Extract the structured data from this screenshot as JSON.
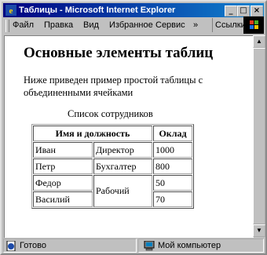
{
  "window": {
    "title": "Таблицы - Microsoft Internet Explorer",
    "buttons": {
      "minimize": "_",
      "maximize": "□",
      "close": "×"
    }
  },
  "menu": {
    "items": [
      "Файл",
      "Правка",
      "Вид",
      "Избранное",
      "Сервис"
    ],
    "links_label": "Ссылки",
    "more": "»"
  },
  "page": {
    "heading": "Основные элементы таблиц",
    "intro": "Ниже приведен пример простой таблицы с объединенными ячейками",
    "caption": "Список сотрудников",
    "table": {
      "headers": [
        "Имя и должность",
        "Оклад"
      ],
      "rows": [
        {
          "name": "Иван",
          "position": "Директор",
          "salary": "1000"
        },
        {
          "name": "Петр",
          "position": "Бухгалтер",
          "salary": "800"
        },
        {
          "name": "Федор",
          "position": "Рабочий",
          "salary": "50"
        },
        {
          "name": "Василий",
          "salary": "70"
        }
      ]
    }
  },
  "status": {
    "text": "Готово",
    "zone": "Мой компьютер"
  },
  "colors": {
    "titlebar": "#000080",
    "chrome": "#c0c0c0"
  },
  "icons": [
    "ie-app-icon",
    "windows-logo-icon",
    "page-status-icon",
    "my-computer-icon"
  ]
}
